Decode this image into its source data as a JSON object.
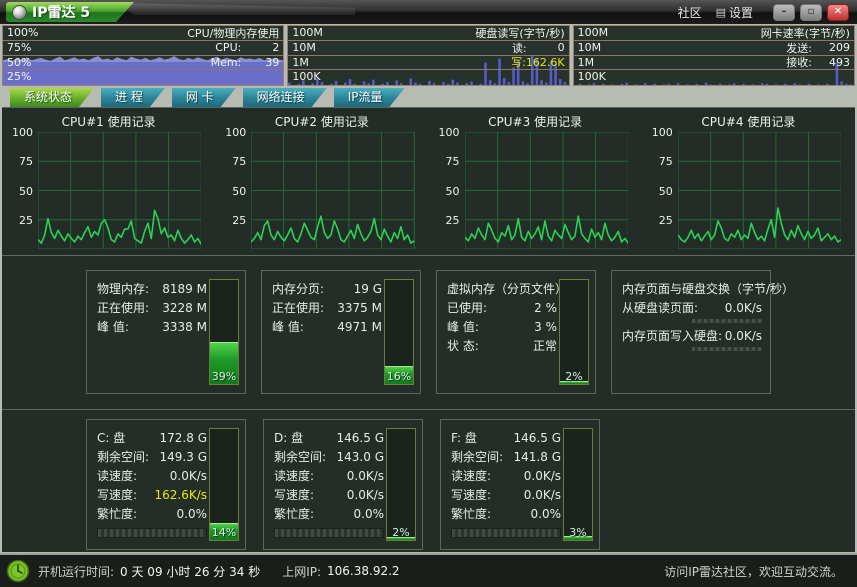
{
  "window": {
    "title": "IP雷达 5"
  },
  "titlebar": {
    "community": "社区",
    "settings": "设置",
    "settings_icon": "▤",
    "minimize": "—",
    "maximize": "▢",
    "close": "x"
  },
  "top_graphs": {
    "cpu_mem": {
      "title": "CPU/物理内存使用",
      "ylabels": [
        "100%",
        "75%",
        "50%",
        "25%"
      ],
      "row1_label": "CPU:",
      "row1_value": "2",
      "row2_label": "Mem:",
      "row2_value": "39"
    },
    "disk": {
      "title": "硬盘读写(字节/秒)",
      "ylabels": [
        "100M",
        "10M",
        "1M",
        "100K"
      ],
      "row1_label": "读:",
      "row1_value": "0",
      "row2_label": "写:",
      "row2_value": "162.6K"
    },
    "net": {
      "title": "网卡速率(字节/秒)",
      "ylabels": [
        "100M",
        "10M",
        "1M",
        "100K"
      ],
      "row1_label": "发送:",
      "row1_value": "209",
      "row2_label": "接收:",
      "row2_value": "493"
    }
  },
  "tabs": [
    {
      "label": "系统状态",
      "active": true
    },
    {
      "label": "进 程",
      "active": false
    },
    {
      "label": "网 卡",
      "active": false
    },
    {
      "label": "网络连接",
      "active": false
    },
    {
      "label": "IP流量",
      "active": false
    }
  ],
  "chart_data": [
    {
      "type": "line",
      "title": "CPU#1 使用记录",
      "ylabels": [
        "100",
        "75",
        "50",
        "25"
      ],
      "ylim": [
        0,
        100
      ],
      "grid": true,
      "legend_position": "none",
      "values": [
        8,
        5,
        12,
        26,
        14,
        9,
        16,
        11,
        7,
        13,
        9,
        6,
        11,
        8,
        14,
        19,
        10,
        15,
        12,
        22,
        25,
        18,
        8,
        6,
        13,
        10,
        17,
        17,
        24,
        9,
        7,
        5,
        15,
        22,
        9,
        33,
        26,
        13,
        18,
        10,
        12,
        7,
        16,
        9,
        5,
        8,
        12,
        6,
        9,
        4
      ]
    },
    {
      "type": "line",
      "title": "CPU#2 使用记录",
      "ylabels": [
        "100",
        "75",
        "50",
        "25"
      ],
      "ylim": [
        0,
        100
      ],
      "grid": true,
      "legend_position": "none",
      "values": [
        6,
        9,
        14,
        8,
        20,
        24,
        12,
        8,
        15,
        10,
        7,
        12,
        18,
        9,
        6,
        13,
        22,
        16,
        10,
        8,
        19,
        28,
        14,
        9,
        12,
        24,
        17,
        8,
        6,
        11,
        16,
        9,
        21,
        13,
        7,
        10,
        15,
        26,
        12,
        8,
        17,
        11,
        6,
        14,
        9,
        19,
        8,
        12,
        5,
        7
      ]
    },
    {
      "type": "line",
      "title": "CPU#3 使用记录",
      "ylabels": [
        "100",
        "75",
        "50",
        "25"
      ],
      "ylim": [
        0,
        100
      ],
      "grid": true,
      "legend_position": "none",
      "values": [
        10,
        7,
        13,
        9,
        18,
        12,
        8,
        22,
        16,
        9,
        6,
        14,
        11,
        20,
        8,
        12,
        26,
        10,
        7,
        15,
        9,
        13,
        19,
        8,
        24,
        11,
        7,
        16,
        12,
        9,
        21,
        14,
        8,
        11,
        28,
        13,
        9,
        6,
        17,
        10,
        14,
        8,
        22,
        12,
        7,
        10,
        15,
        6,
        9,
        5
      ]
    },
    {
      "type": "line",
      "title": "CPU#4 使用记录",
      "ylabels": [
        "100",
        "75",
        "50",
        "25"
      ],
      "ylim": [
        0,
        100
      ],
      "grid": true,
      "legend_position": "none",
      "values": [
        12,
        8,
        6,
        10,
        16,
        9,
        13,
        7,
        11,
        15,
        8,
        12,
        24,
        18,
        9,
        7,
        13,
        10,
        16,
        8,
        12,
        9,
        22,
        14,
        8,
        11,
        7,
        17,
        25,
        10,
        35,
        22,
        12,
        8,
        16,
        10,
        20,
        13,
        8,
        15,
        9,
        12,
        18,
        7,
        10,
        13,
        8,
        11,
        6,
        8
      ]
    },
    {
      "type": "area",
      "title": "CPU/物理内存使用 (顶部小图)",
      "mem_band_pct": 39,
      "cpu_spikes": [
        3,
        5,
        2,
        6,
        4,
        8,
        3,
        5,
        7,
        4,
        2,
        6,
        9,
        3,
        5,
        8,
        4,
        6,
        3,
        7,
        10,
        4,
        6,
        3,
        8,
        5,
        3,
        9,
        6,
        4,
        7,
        3,
        5,
        8,
        4,
        6,
        10,
        5,
        3,
        7,
        4,
        8,
        5,
        3,
        6,
        9,
        4,
        7,
        5,
        3,
        8,
        5,
        6,
        4,
        7,
        3,
        5,
        6,
        4,
        3
      ]
    },
    {
      "type": "bar",
      "title": "硬盘读写 (顶部小图)",
      "values": [
        4,
        0,
        2,
        8,
        0,
        3,
        12,
        5,
        0,
        2,
        7,
        0,
        4,
        10,
        2,
        0,
        6,
        3,
        9,
        0,
        2,
        5,
        0,
        8,
        3,
        0,
        11,
        4,
        2,
        0,
        7,
        3,
        0,
        5,
        2,
        9,
        4,
        0,
        3,
        6,
        0,
        2,
        38,
        8,
        3,
        45,
        12,
        5,
        30,
        42,
        6,
        3,
        50,
        44,
        8,
        4,
        40,
        36,
        10,
        5
      ]
    },
    {
      "type": "bar",
      "title": "网卡速率 (顶部小图)",
      "values": [
        0,
        2,
        0,
        1,
        3,
        0,
        2,
        0,
        1,
        0,
        2,
        4,
        0,
        1,
        0,
        3,
        0,
        2,
        0,
        1,
        2,
        0,
        3,
        0,
        1,
        0,
        2,
        0,
        4,
        1,
        0,
        2,
        0,
        1,
        3,
        0,
        2,
        0,
        1,
        0,
        3,
        2,
        0,
        1,
        0,
        2,
        0,
        3,
        1,
        0,
        2,
        0,
        1,
        0,
        2,
        0,
        38,
        6,
        2,
        1
      ]
    }
  ],
  "memory_panels": [
    {
      "rows": [
        {
          "label": "物理内存:",
          "value": "8189 M"
        },
        {
          "label": "正在使用:",
          "value": "3228 M"
        },
        {
          "label": "峰  值:",
          "value": "3338 M"
        }
      ],
      "gauge_pct": 39,
      "gauge_label": "39%"
    },
    {
      "rows": [
        {
          "label": "内存分页:",
          "value": "19 G"
        },
        {
          "label": "正在使用:",
          "value": "3375 M"
        },
        {
          "label": "峰  值:",
          "value": "4971 M"
        }
      ],
      "gauge_pct": 16,
      "gauge_label": "16%"
    },
    {
      "title": "虚拟内存（分页文件）",
      "rows": [
        {
          "label": "已使用:",
          "value": "2 %"
        },
        {
          "label": "峰  值:",
          "value": "3 %"
        },
        {
          "label": "状  态:",
          "value": "正常"
        }
      ],
      "gauge_pct": 2,
      "gauge_label": "2%"
    },
    {
      "title": "内存页面与硬盘交换（字节/秒）",
      "rows": [
        {
          "label": "从硬盘读页面:",
          "value": "0.0K/s"
        },
        {
          "label": "内存页面写入硬盘:",
          "value": "0.0K/s"
        }
      ]
    }
  ],
  "disk_panels": [
    {
      "rows": [
        {
          "label": "C: 盘",
          "value": "172.8 G"
        },
        {
          "label": "剩余空间:",
          "value": "149.3 G"
        },
        {
          "label": "读速度:",
          "value": "0.0K/s"
        },
        {
          "label": "写速度:",
          "value": "162.6K/s",
          "highlight": true
        },
        {
          "label": "繁忙度:",
          "value": "0.0%"
        }
      ],
      "gauge_pct": 14,
      "gauge_label": "14%"
    },
    {
      "rows": [
        {
          "label": "D: 盘",
          "value": "146.5 G"
        },
        {
          "label": "剩余空间:",
          "value": "143.0 G"
        },
        {
          "label": "读速度:",
          "value": "0.0K/s"
        },
        {
          "label": "写速度:",
          "value": "0.0K/s"
        },
        {
          "label": "繁忙度:",
          "value": "0.0%"
        }
      ],
      "gauge_pct": 2,
      "gauge_label": "2%"
    },
    {
      "rows": [
        {
          "label": "F: 盘",
          "value": "146.5 G"
        },
        {
          "label": "剩余空间:",
          "value": "141.8 G"
        },
        {
          "label": "读速度:",
          "value": "0.0K/s"
        },
        {
          "label": "写速度:",
          "value": "0.0K/s"
        },
        {
          "label": "繁忙度:",
          "value": "0.0%"
        }
      ],
      "gauge_pct": 3,
      "gauge_label": "3%"
    }
  ],
  "statusbar": {
    "uptime_label": "开机运行时间:",
    "uptime_value": "0 天 09 小时 26 分 34 秒",
    "ip_label": "上网IP:",
    "ip_value": "106.38.92.2",
    "right_text": "访问IP雷达社区，欢迎互动交流。"
  },
  "colors": {
    "accent_green": "#2bd155",
    "grid_green": "#1e6e34",
    "mem_purple": "#7173d6",
    "spike_blue": "#5560cf",
    "highlight_yellow": "#e8e80a",
    "tab_active": "#66ae2a",
    "tab_inactive": "#2b8296"
  }
}
